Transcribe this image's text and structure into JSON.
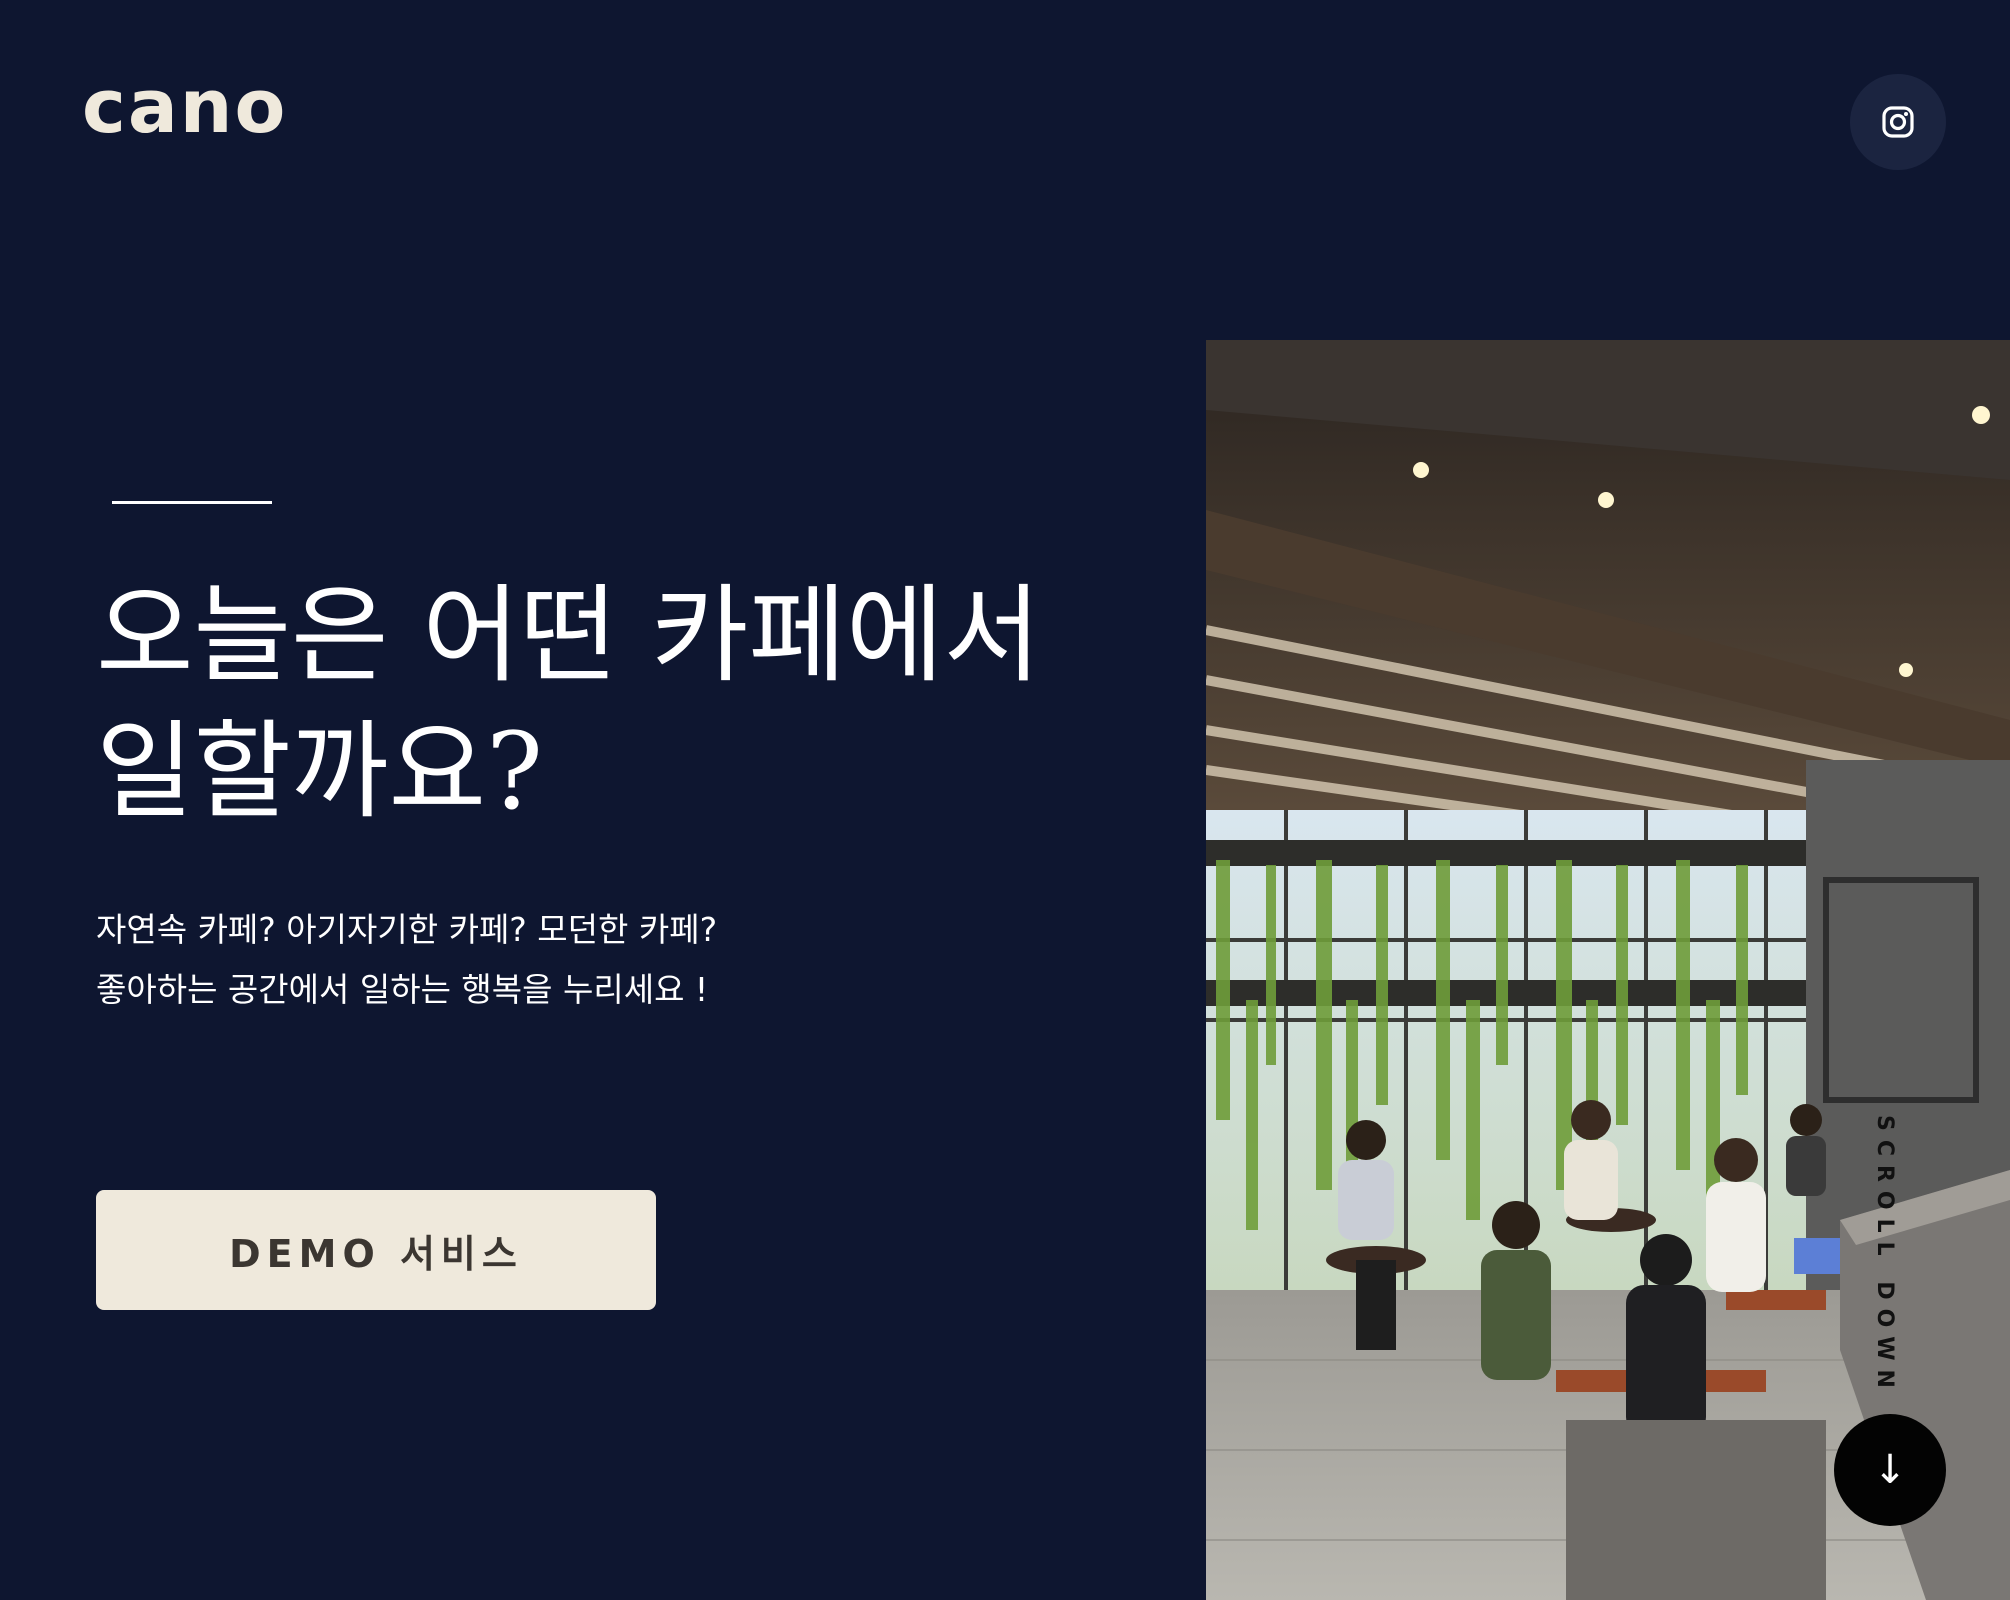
{
  "header": {
    "logo": "cano",
    "instagram_icon": "instagram-icon"
  },
  "hero": {
    "title_line1": "오늘은 어떤 카페에서",
    "title_line2": "일할까요?",
    "desc_line1": "자연속 카페? 아기자기한 카페? 모던한 카페?",
    "desc_line2": "좋아하는 공간에서 일하는 행복을 누리세요 !",
    "cta_label": "DEMO 서비스"
  },
  "scroll": {
    "label": "SCROLL DOWN",
    "icon": "arrow-down-icon",
    "glyph": "↓"
  },
  "colors": {
    "background": "#0e1630",
    "cream": "#efe9dc",
    "text": "#ffffff"
  }
}
